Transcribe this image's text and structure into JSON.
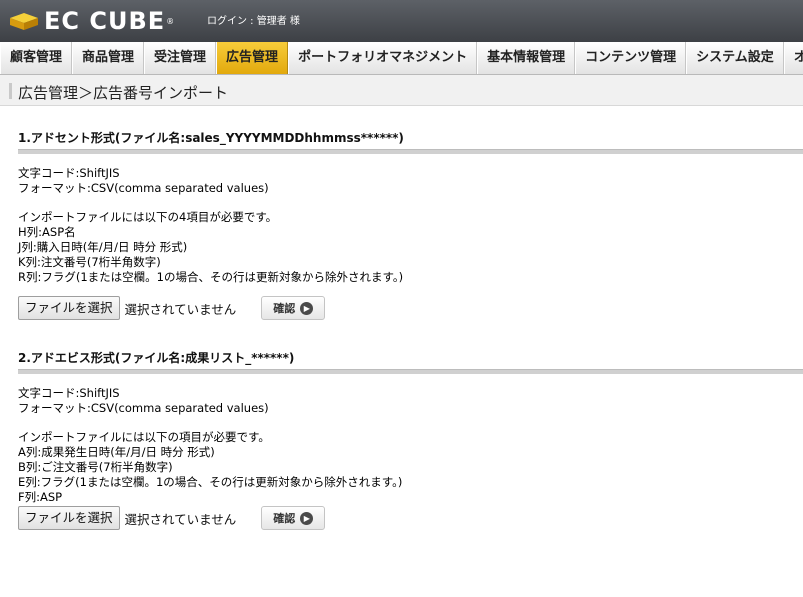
{
  "header": {
    "brand": "EC CUBE",
    "login_text": "ログイン : 管理者 様"
  },
  "nav": {
    "items": [
      {
        "label": "顧客管理"
      },
      {
        "label": "商品管理"
      },
      {
        "label": "受注管理"
      },
      {
        "label": "広告管理",
        "active": true
      },
      {
        "label": "ポートフォリオマネジメント"
      },
      {
        "label": "基本情報管理"
      },
      {
        "label": "コンテンツ管理"
      },
      {
        "label": "システム設定"
      },
      {
        "label": "オーナーズ"
      }
    ]
  },
  "page": {
    "title": "広告管理＞広告番号インポート"
  },
  "sections": [
    {
      "heading": "1.アドセント形式(ファイル名:sales_YYYYMMDDhhmmss******)",
      "lines": [
        "文字コード:ShiftJIS",
        "フォーマット:CSV(comma separated values)",
        "",
        "インポートファイルには以下の4項目が必要です。",
        "H列:ASP名",
        "J列:購入日時(年/月/日 時分 形式)",
        "K列:注文番号(7桁半角数字)",
        "R列:フラグ(1または空欄。1の場合、その行は更新対象から除外されます。)"
      ],
      "file_button": "ファイルを選択",
      "file_status": "選択されていません",
      "confirm_button": "確認"
    },
    {
      "heading": "2.アドエビス形式(ファイル名:成果リスト_******)",
      "lines": [
        "文字コード:ShiftJIS",
        "フォーマット:CSV(comma separated values)",
        "",
        "インポートファイルには以下の項目が必要です。",
        "A列:成果発生日時(年/月/日 時分 形式)",
        "B列:ご注文番号(7桁半角数字)",
        "E列:フラグ(1または空欄。1の場合、その行は更新対象から除外されます。)",
        "F列:ASP"
      ],
      "file_button": "ファイルを選択",
      "file_status": "選択されていません",
      "confirm_button": "確認"
    }
  ],
  "colors": {
    "header_bg": "#4a4d52",
    "nav_active": "#eab320",
    "logo_gold": "#f1c40f"
  }
}
